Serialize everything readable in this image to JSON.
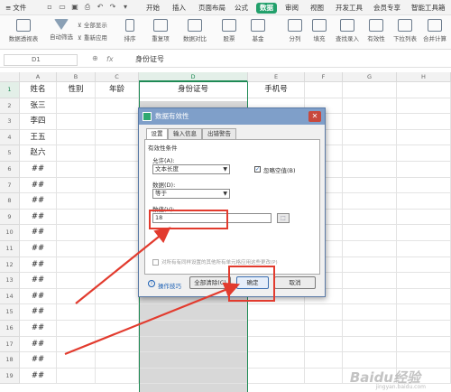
{
  "menubar": {
    "file_label": "文件",
    "tabs": [
      "开始",
      "插入",
      "页面布局",
      "公式",
      "数据",
      "审阅",
      "视图",
      "开发工具",
      "会员专享",
      "智能工具箱"
    ],
    "active_tab": "数据"
  },
  "ribbon": {
    "pivot_label": "数据透视表",
    "autofilter_label": "自动筛选",
    "show_all_label": "全部显示",
    "reapply_label": "重新应用",
    "sort_label": "排序",
    "dup_label": "重复项",
    "compare_label": "数据对比",
    "stock_label": "股票",
    "fund_label": "基金",
    "split_label": "分列",
    "fill_label": "填充",
    "lookup_label": "查找录入",
    "validity_label": "有效性",
    "dropdown_label": "下拉列表",
    "merge_label": "合并计算"
  },
  "formula_bar": {
    "cell_ref": "D1",
    "fx": "fx",
    "content": "身份证号"
  },
  "columns": [
    "A",
    "B",
    "C",
    "D",
    "E",
    "F",
    "G",
    "H"
  ],
  "rows": [
    "1",
    "2",
    "3",
    "4",
    "5",
    "6",
    "7",
    "8",
    "9",
    "10",
    "11",
    "12",
    "13",
    "14",
    "15",
    "16",
    "17",
    "18",
    "19"
  ],
  "header_row": [
    "姓名",
    "性别",
    "年龄",
    "身份证号",
    "手机号"
  ],
  "names": [
    "张三",
    "李四",
    "王五",
    "赵六",
    "##",
    "##",
    "##",
    "##",
    "##",
    "##",
    "##",
    "##",
    "##",
    "##",
    "##",
    "##",
    "##",
    "##"
  ],
  "dialog": {
    "title": "数据有效性",
    "tabs": [
      "设置",
      "输入信息",
      "出错警告"
    ],
    "criteria_label": "有效性条件",
    "allow_label": "允许(A):",
    "allow_value": "文本长度",
    "ignore_blank_label": "忽略空值(B)",
    "data_label": "数据(D):",
    "data_value": "等于",
    "value_label": "数值(V):",
    "value_value": "18",
    "apply_all_label": "对所有有同样设置的其他所有单元格应用这些更改(P)",
    "tips_label": "操作技巧",
    "clear_label": "全部清除(C)",
    "ok_label": "确定",
    "cancel_label": "取消"
  },
  "watermark": {
    "main": "Baidu经验",
    "sub": "jingyan.baidu.com"
  }
}
